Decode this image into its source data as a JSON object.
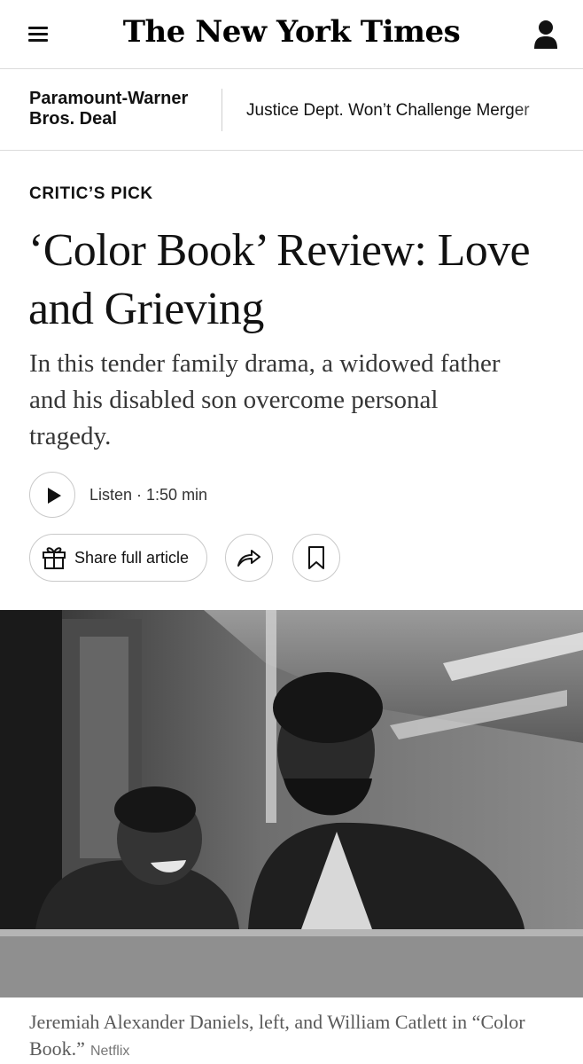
{
  "header": {
    "logo_text": "The New York Times",
    "menu_icon": "hamburger-menu-icon",
    "account_icon": "user-account-icon"
  },
  "ticker": {
    "label": "Paramount-Warner Bros. Deal",
    "headline": "Justice Dept. Won’t Challenge Merger"
  },
  "article": {
    "kicker": "CRITIC’S PICK",
    "headline": "‘Color Book’ Review: Love and Grieving",
    "summary": "In this tender family drama, a widowed father and his disabled son overcome personal tragedy.",
    "listen_label": "Listen · 1:50 min",
    "share_label": "Share full article",
    "share_icon": "gift-icon",
    "forward_icon": "share-arrow-icon",
    "save_icon": "bookmark-icon"
  },
  "photo": {
    "caption": "Jeremiah Alexander Daniels, left, and William Catlett in “Color Book.”",
    "credit": "Netflix"
  },
  "colors": {
    "text": "#121212",
    "border": "#dcdcdc",
    "summary": "#363636"
  }
}
